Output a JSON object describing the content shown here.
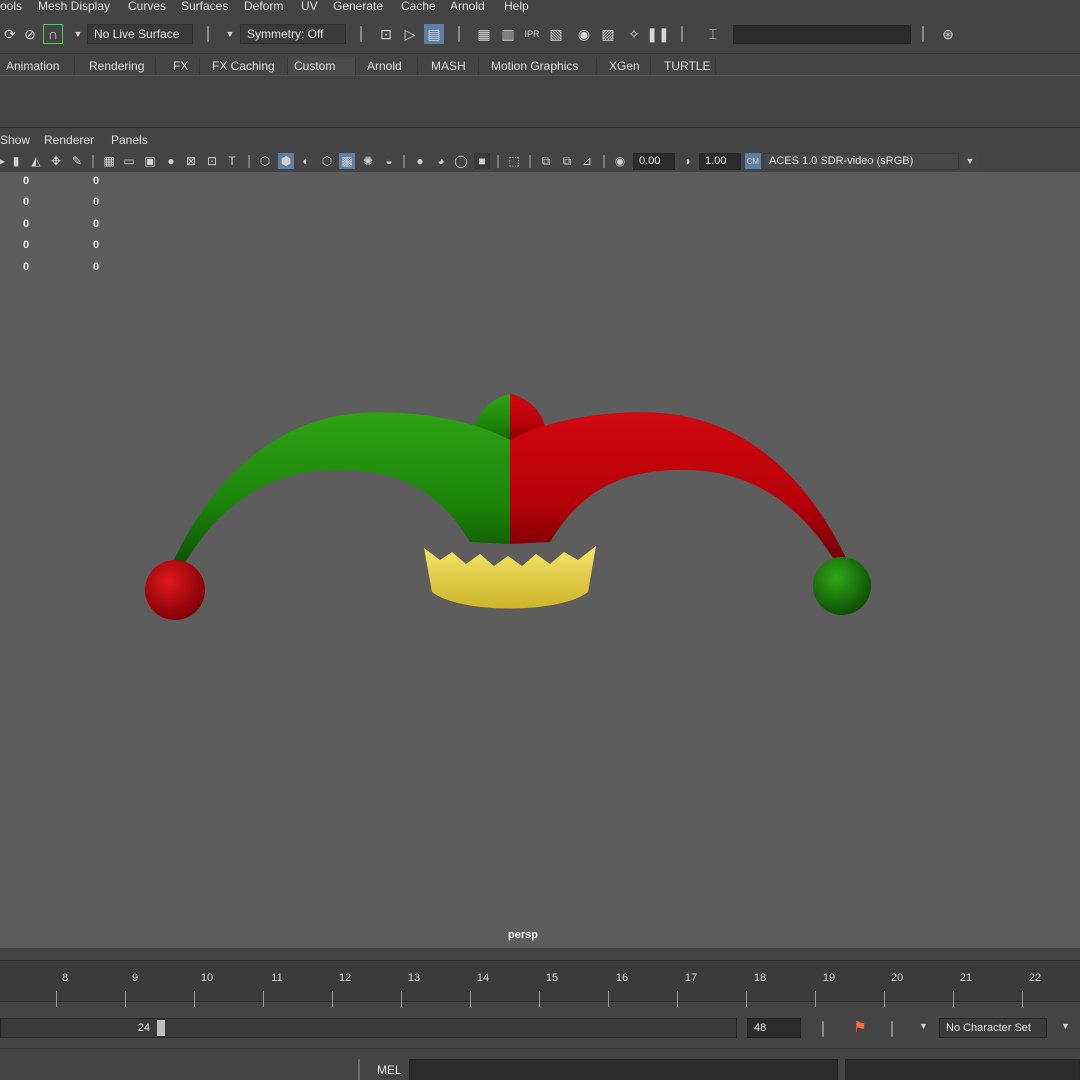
{
  "menubar": {
    "items": [
      "ools",
      "Mesh Display",
      "Curves",
      "Surfaces",
      "Deform",
      "UV",
      "Generate",
      "Cache",
      "Arnold",
      "Help"
    ]
  },
  "statusline": {
    "live_surface": "No Live Surface",
    "symmetry": "Symmetry: Off"
  },
  "shelf": {
    "tabs": [
      "Animation",
      "Rendering",
      "FX",
      "FX Caching",
      "Custom",
      "Arnold",
      "MASH",
      "Motion Graphics",
      "XGen",
      "TURTLE"
    ],
    "active_tab": "Custom"
  },
  "panel": {
    "menus": [
      "Show",
      "Renderer",
      "Panels"
    ],
    "exposure": "0.00",
    "gamma": "1.00",
    "color_space": "ACES 1.0 SDR-video (sRGB)",
    "camera_label": "persp"
  },
  "hud": {
    "rows": [
      [
        "0",
        "0"
      ],
      [
        "0",
        "0"
      ],
      [
        "0",
        "0"
      ],
      [
        "0",
        "0"
      ],
      [
        "0",
        "0"
      ]
    ]
  },
  "colors": {
    "hat_green": "#1f8c0a",
    "hat_red": "#c0000c",
    "crown_yellow": "#e6d23a",
    "viewport_bg": "#5d5d5d"
  },
  "timeslider": {
    "frames": [
      "8",
      "9",
      "10",
      "11",
      "12",
      "13",
      "14",
      "15",
      "16",
      "17",
      "18",
      "19",
      "20",
      "21",
      "22"
    ]
  },
  "range": {
    "current_end": "24",
    "anim_end": "48",
    "character_set": "No Character Set"
  },
  "cmdline": {
    "language": "MEL"
  }
}
